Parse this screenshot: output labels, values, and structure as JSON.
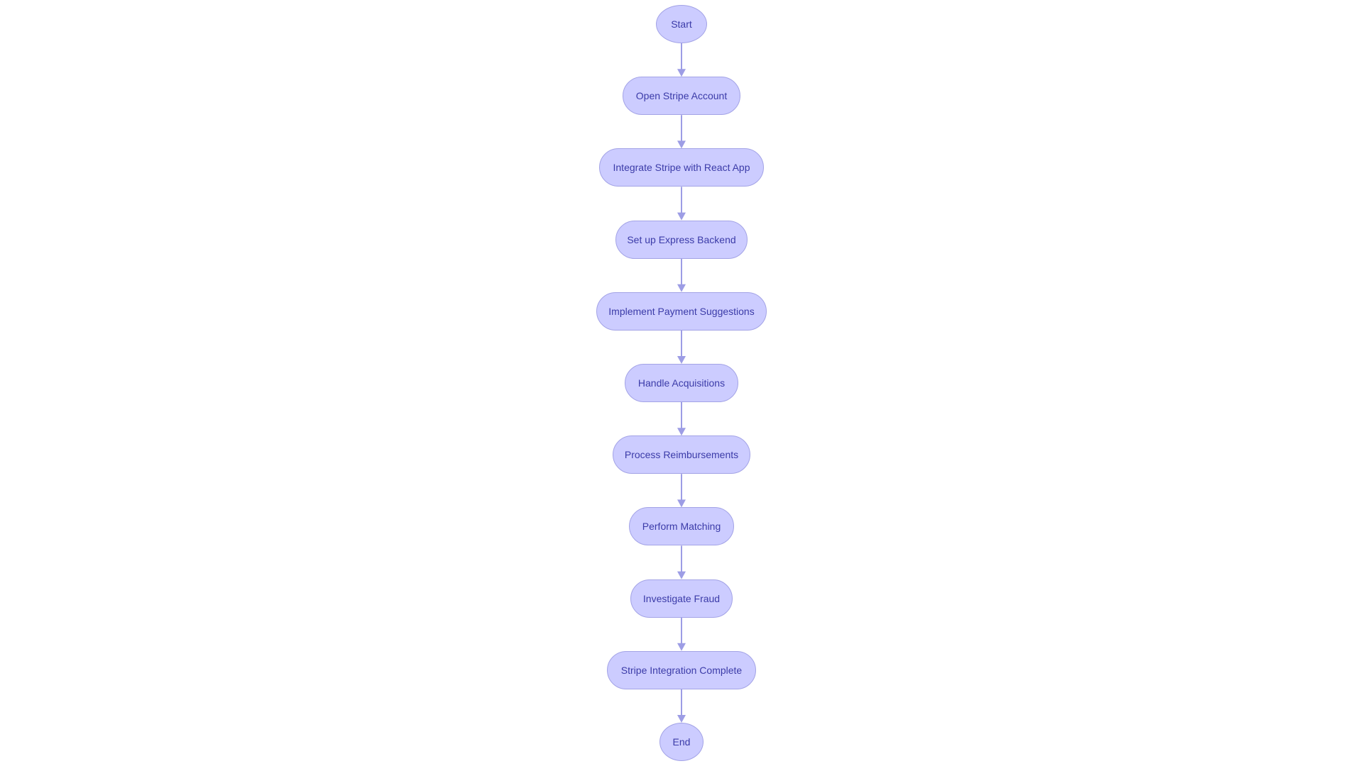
{
  "colors": {
    "node_fill": "#ccccff",
    "node_stroke": "#a3a3e6",
    "node_text": "#3b3ba8",
    "edge": "#9d9de5"
  },
  "diagram": {
    "type": "flowchart",
    "direction": "top-to-bottom",
    "nodes": [
      {
        "id": "start",
        "label": "Start",
        "shape": "circle"
      },
      {
        "id": "open",
        "label": "Open Stripe Account",
        "shape": "stadium"
      },
      {
        "id": "integrate",
        "label": "Integrate Stripe with React App",
        "shape": "stadium"
      },
      {
        "id": "backend",
        "label": "Set up Express Backend",
        "shape": "stadium"
      },
      {
        "id": "payments",
        "label": "Implement Payment Suggestions",
        "shape": "stadium"
      },
      {
        "id": "acquisitions",
        "label": "Handle Acquisitions",
        "shape": "stadium"
      },
      {
        "id": "reimburse",
        "label": "Process Reimbursements",
        "shape": "stadium"
      },
      {
        "id": "matching",
        "label": "Perform Matching",
        "shape": "stadium"
      },
      {
        "id": "fraud",
        "label": "Investigate Fraud",
        "shape": "stadium"
      },
      {
        "id": "complete",
        "label": "Stripe Integration Complete",
        "shape": "stadium"
      },
      {
        "id": "end",
        "label": "End",
        "shape": "circle"
      }
    ],
    "edges": [
      {
        "from": "start",
        "to": "open"
      },
      {
        "from": "open",
        "to": "integrate"
      },
      {
        "from": "integrate",
        "to": "backend"
      },
      {
        "from": "backend",
        "to": "payments"
      },
      {
        "from": "payments",
        "to": "acquisitions"
      },
      {
        "from": "acquisitions",
        "to": "reimburse"
      },
      {
        "from": "reimburse",
        "to": "matching"
      },
      {
        "from": "matching",
        "to": "fraud"
      },
      {
        "from": "fraud",
        "to": "complete"
      },
      {
        "from": "complete",
        "to": "end"
      }
    ]
  }
}
